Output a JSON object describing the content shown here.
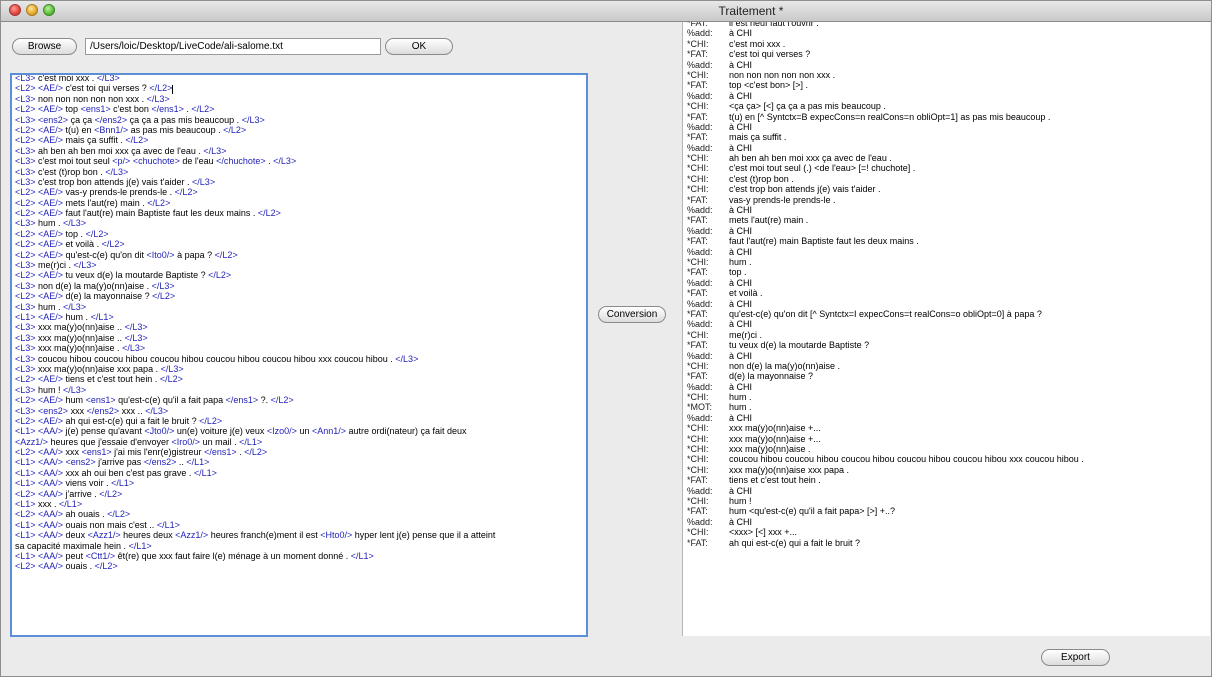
{
  "window": {
    "title": "Traitement *"
  },
  "toolbar": {
    "browse_label": "Browse",
    "path_value": "/Users/loic/Desktop/LiveCode/ali-salome.txt",
    "ok_label": "OK"
  },
  "conversion_label": "Conversion",
  "export_label": "Export",
  "editor_lines": [
    [
      [
        "t",
        "<L3>"
      ],
      [
        "x",
        " c'est moi xxx . "
      ],
      [
        "t",
        "</L3>"
      ]
    ],
    [
      [
        "t",
        "<L2> <AE/>"
      ],
      [
        "x",
        " c'est toi qui verses ? "
      ],
      [
        "t",
        "</L2>"
      ]
    ],
    [
      [
        "t",
        "<L3>"
      ],
      [
        "x",
        " non non non non non xxx . "
      ],
      [
        "t",
        "</L3>"
      ]
    ],
    [
      [
        "t",
        "<L2> <AE/>"
      ],
      [
        "x",
        " top "
      ],
      [
        "t",
        "<ens1>"
      ],
      [
        "x",
        " c'est bon "
      ],
      [
        "t",
        "</ens1>"
      ],
      [
        "x",
        " . "
      ],
      [
        "t",
        "</L2>"
      ]
    ],
    [
      [
        "t",
        "<L3> <ens2>"
      ],
      [
        "x",
        " ça ça "
      ],
      [
        "t",
        "</ens2>"
      ],
      [
        "x",
        " ça ça a pas mis beaucoup . "
      ],
      [
        "t",
        "</L3>"
      ]
    ],
    [
      [
        "t",
        "<L2> <AE/>"
      ],
      [
        "x",
        " t(u) en "
      ],
      [
        "t",
        "<Bnn1/>"
      ],
      [
        "x",
        " as pas mis beaucoup . "
      ],
      [
        "t",
        "</L2>"
      ]
    ],
    [
      [
        "t",
        "<L2> <AE/>"
      ],
      [
        "x",
        " mais ça suffit . "
      ],
      [
        "t",
        "</L2>"
      ]
    ],
    [
      [
        "t",
        "<L3>"
      ],
      [
        "x",
        " ah ben ah ben moi xxx ça avec de l'eau . "
      ],
      [
        "t",
        "</L3>"
      ]
    ],
    [
      [
        "t",
        "<L3>"
      ],
      [
        "x",
        " c'est moi tout seul "
      ],
      [
        "t",
        "<p/> <chuchote>"
      ],
      [
        "x",
        " de l'eau "
      ],
      [
        "t",
        "</chuchote>"
      ],
      [
        "x",
        " . "
      ],
      [
        "t",
        "</L3>"
      ]
    ],
    [
      [
        "t",
        "<L3>"
      ],
      [
        "x",
        " c'est (t)rop bon . "
      ],
      [
        "t",
        "</L3>"
      ]
    ],
    [
      [
        "t",
        "<L3>"
      ],
      [
        "x",
        " c'est trop bon attends j(e) vais t'aider . "
      ],
      [
        "t",
        "</L3>"
      ]
    ],
    [
      [
        "t",
        "<L2> <AE/>"
      ],
      [
        "x",
        " vas-y prends-le prends-le . "
      ],
      [
        "t",
        "</L2>"
      ]
    ],
    [
      [
        "t",
        "<L2> <AE/>"
      ],
      [
        "x",
        " mets l'aut(re) main . "
      ],
      [
        "t",
        "</L2>"
      ]
    ],
    [
      [
        "t",
        "<L2> <AE/>"
      ],
      [
        "x",
        " faut l'aut(re) main Baptiste faut les deux mains . "
      ],
      [
        "t",
        "</L2>"
      ]
    ],
    [
      [
        "t",
        "<L3>"
      ],
      [
        "x",
        " hum . "
      ],
      [
        "t",
        "</L3>"
      ]
    ],
    [
      [
        "t",
        "<L2> <AE/>"
      ],
      [
        "x",
        " top . "
      ],
      [
        "t",
        "</L2>"
      ]
    ],
    [
      [
        "t",
        "<L2> <AE/>"
      ],
      [
        "x",
        " et voilà . "
      ],
      [
        "t",
        "</L2>"
      ]
    ],
    [
      [
        "t",
        "<L2> <AE/>"
      ],
      [
        "x",
        " qu'est-c(e) qu'on dit "
      ],
      [
        "t",
        "<Ito0/>"
      ],
      [
        "x",
        " à papa ? "
      ],
      [
        "t",
        "</L2>"
      ]
    ],
    [
      [
        "t",
        "<L3>"
      ],
      [
        "x",
        " me(r)ci . "
      ],
      [
        "t",
        "</L3>"
      ]
    ],
    [
      [
        "t",
        "<L2> <AE/>"
      ],
      [
        "x",
        " tu veux d(e) la moutarde Baptiste ? "
      ],
      [
        "t",
        "</L2>"
      ]
    ],
    [
      [
        "t",
        "<L3>"
      ],
      [
        "x",
        " non d(e) la ma(y)o(nn)aise . "
      ],
      [
        "t",
        "</L3>"
      ]
    ],
    [
      [
        "t",
        "<L2> <AE/>"
      ],
      [
        "x",
        " d(e) la mayonnaise ? "
      ],
      [
        "t",
        "</L2>"
      ]
    ],
    [
      [
        "t",
        "<L3>"
      ],
      [
        "x",
        " hum . "
      ],
      [
        "t",
        "</L3>"
      ]
    ],
    [
      [
        "t",
        "<L1> <AE/>"
      ],
      [
        "x",
        " hum . "
      ],
      [
        "t",
        "</L1>"
      ]
    ],
    [
      [
        "t",
        "<L3>"
      ],
      [
        "x",
        " xxx ma(y)o(nn)aise .. "
      ],
      [
        "t",
        "</L3>"
      ]
    ],
    [
      [
        "t",
        "<L3>"
      ],
      [
        "x",
        " xxx ma(y)o(nn)aise .. "
      ],
      [
        "t",
        "</L3>"
      ]
    ],
    [
      [
        "t",
        "<L3>"
      ],
      [
        "x",
        " xxx ma(y)o(nn)aise . "
      ],
      [
        "t",
        "</L3>"
      ]
    ],
    [
      [
        "t",
        "<L3>"
      ],
      [
        "x",
        " coucou hibou coucou hibou coucou hibou coucou hibou coucou hibou xxx coucou hibou . "
      ],
      [
        "t",
        "</L3>"
      ]
    ],
    [
      [
        "t",
        "<L3>"
      ],
      [
        "x",
        " xxx ma(y)o(nn)aise xxx papa . "
      ],
      [
        "t",
        "</L3>"
      ]
    ],
    [
      [
        "t",
        "<L2> <AE/>"
      ],
      [
        "x",
        " tiens et c'est tout hein . "
      ],
      [
        "t",
        "</L2>"
      ]
    ],
    [
      [
        "t",
        "<L3>"
      ],
      [
        "x",
        " hum ! "
      ],
      [
        "t",
        "</L3>"
      ]
    ],
    [
      [
        "t",
        "<L2> <AE/>"
      ],
      [
        "x",
        " hum "
      ],
      [
        "t",
        "<ens1>"
      ],
      [
        "x",
        " qu'est-c(e) qu'il a fait papa "
      ],
      [
        "t",
        "</ens1>"
      ],
      [
        "x",
        " ?. "
      ],
      [
        "t",
        "</L2>"
      ]
    ],
    [
      [
        "t",
        "<L3> <ens2>"
      ],
      [
        "x",
        " xxx "
      ],
      [
        "t",
        "</ens2>"
      ],
      [
        "x",
        " xxx .. "
      ],
      [
        "t",
        "</L3>"
      ]
    ],
    [
      [
        "t",
        "<L2> <AE/>"
      ],
      [
        "x",
        " ah qui est-c(e) qui a fait le bruit ? "
      ],
      [
        "t",
        "</L2>"
      ]
    ],
    [
      [
        "t",
        "<L1> <AA/>"
      ],
      [
        "x",
        " j(e) pense qu'avant "
      ],
      [
        "t",
        "<Jto0/>"
      ],
      [
        "x",
        " un(e) voiture j(e) veux "
      ],
      [
        "t",
        "<Izo0/>"
      ],
      [
        "x",
        " un "
      ],
      [
        "t",
        "<Ann1/>"
      ],
      [
        "x",
        " autre ordi(nateur) ça fait deux"
      ]
    ],
    [
      [
        "t",
        "<Azz1/>"
      ],
      [
        "x",
        " heures que j'essaie d'envoyer "
      ],
      [
        "t",
        "<Iro0/>"
      ],
      [
        "x",
        " un mail . "
      ],
      [
        "t",
        "</L1>"
      ]
    ],
    [
      [
        "t",
        "<L2> <AA/>"
      ],
      [
        "x",
        " xxx "
      ],
      [
        "t",
        "<ens1>"
      ],
      [
        "x",
        " j'ai mis l'enr(e)gistreur "
      ],
      [
        "t",
        "</ens1>"
      ],
      [
        "x",
        " . "
      ],
      [
        "t",
        "</L2>"
      ]
    ],
    [
      [
        "t",
        "<L1> <AA/> <ens2>"
      ],
      [
        "x",
        " j'arrive pas "
      ],
      [
        "t",
        "</ens2>"
      ],
      [
        "x",
        " .. "
      ],
      [
        "t",
        "</L1>"
      ]
    ],
    [
      [
        "t",
        "<L1> <AA/>"
      ],
      [
        "x",
        " xxx ah oui ben c'est pas grave . "
      ],
      [
        "t",
        "</L1>"
      ]
    ],
    [
      [
        "t",
        "<L1> <AA/>"
      ],
      [
        "x",
        " viens voir . "
      ],
      [
        "t",
        "</L1>"
      ]
    ],
    [
      [
        "t",
        "<L2> <AA/>"
      ],
      [
        "x",
        " j'arrive . "
      ],
      [
        "t",
        "</L2>"
      ]
    ],
    [
      [
        "t",
        "<L1>"
      ],
      [
        "x",
        " xxx . "
      ],
      [
        "t",
        "</L1>"
      ]
    ],
    [
      [
        "t",
        "<L2> <AA/>"
      ],
      [
        "x",
        " ah ouais . "
      ],
      [
        "t",
        "</L2>"
      ]
    ],
    [
      [
        "t",
        "<L1> <AA/>"
      ],
      [
        "x",
        " ouais non mais c'est .. "
      ],
      [
        "t",
        "</L1>"
      ]
    ],
    [
      [
        "t",
        "<L1> <AA/>"
      ],
      [
        "x",
        " deux "
      ],
      [
        "t",
        "<Azz1/>"
      ],
      [
        "x",
        " heures deux "
      ],
      [
        "t",
        "<Azz1/>"
      ],
      [
        "x",
        " heures franch(e)ment il est "
      ],
      [
        "t",
        "<Hto0/>"
      ],
      [
        "x",
        " hyper lent j(e) pense que il a atteint"
      ]
    ],
    [
      [
        "x",
        "sa capacité maximale hein . "
      ],
      [
        "t",
        "</L1>"
      ]
    ],
    [
      [
        "t",
        "<L1> <AA/>"
      ],
      [
        "x",
        " peut "
      ],
      [
        "t",
        "<Ctt1/>"
      ],
      [
        "x",
        " êt(re) que xxx faut faire l(e) ménage à un moment donné . "
      ],
      [
        "t",
        "</L1>"
      ]
    ],
    [
      [
        "t",
        "<L2> <AA/>"
      ],
      [
        "x",
        " ouais . "
      ],
      [
        "t",
        "</L2>"
      ]
    ]
  ],
  "output_lines": [
    [
      "*FAT:",
      "il est neuf faut l'ouvrir ."
    ],
    [
      "%add:",
      "à CHI"
    ],
    [
      "*CHI:",
      "c'est moi xxx ."
    ],
    [
      "*FAT:",
      "c'est toi qui verses ?"
    ],
    [
      "%add:",
      "à CHI"
    ],
    [
      "*CHI:",
      "non non non non non xxx ."
    ],
    [
      "*FAT:",
      "top <c'est bon> [>] ."
    ],
    [
      "%add:",
      "à CHI"
    ],
    [
      "*CHI:",
      "<ça ça> [<] ça ça a pas mis beaucoup ."
    ],
    [
      "*FAT:",
      "t(u) en [^ Syntctx=B expecCons=n realCons=n obliOpt=1] as pas mis beaucoup ."
    ],
    [
      "%add:",
      "à CHI"
    ],
    [
      "*FAT:",
      "mais ça suffit ."
    ],
    [
      "%add:",
      "à CHI"
    ],
    [
      "*CHI:",
      "ah ben ah ben moi xxx ça avec de l'eau ."
    ],
    [
      "*CHI:",
      "c'est moi tout seul (.) <de l'eau> [=! chuchote] ."
    ],
    [
      "*CHI:",
      "c'est (t)rop bon ."
    ],
    [
      "*CHI:",
      "c'est trop bon attends j(e) vais t'aider ."
    ],
    [
      "*FAT:",
      "vas-y prends-le prends-le ."
    ],
    [
      "%add:",
      "à CHI"
    ],
    [
      "*FAT:",
      "mets l'aut(re) main ."
    ],
    [
      "%add:",
      "à CHI"
    ],
    [
      "*FAT:",
      "faut l'aut(re) main Baptiste faut les deux mains ."
    ],
    [
      "%add:",
      "à CHI"
    ],
    [
      "*CHI:",
      "hum ."
    ],
    [
      "*FAT:",
      "top ."
    ],
    [
      "%add:",
      "à CHI"
    ],
    [
      "*FAT:",
      "et voilà ."
    ],
    [
      "%add:",
      "à CHI"
    ],
    [
      "*FAT:",
      "qu'est-c(e) qu'on dit [^ Syntctx=I expecCons=t realCons=o obliOpt=0] à papa ?"
    ],
    [
      "%add:",
      "à CHI"
    ],
    [
      "*CHI:",
      "me(r)ci ."
    ],
    [
      "*FAT:",
      "tu veux d(e) la moutarde Baptiste ?"
    ],
    [
      "%add:",
      "à CHI"
    ],
    [
      "*CHI:",
      "non d(e) la ma(y)o(nn)aise ."
    ],
    [
      "*FAT:",
      "d(e) la mayonnaise ?"
    ],
    [
      "%add:",
      "à CHI"
    ],
    [
      "*CHI:",
      "hum ."
    ],
    [
      "*MOT:",
      "hum ."
    ],
    [
      "%add:",
      "à CHI"
    ],
    [
      "*CHI:",
      "xxx ma(y)o(nn)aise +..."
    ],
    [
      "*CHI:",
      "xxx ma(y)o(nn)aise +..."
    ],
    [
      "*CHI:",
      "xxx ma(y)o(nn)aise ."
    ],
    [
      "*CHI:",
      "coucou hibou coucou hibou coucou hibou coucou hibou coucou hibou xxx coucou hibou ."
    ],
    [
      "*CHI:",
      "xxx ma(y)o(nn)aise xxx papa ."
    ],
    [
      "*FAT:",
      "tiens et c'est tout hein ."
    ],
    [
      "%add:",
      "à CHI"
    ],
    [
      "*CHI:",
      "hum !"
    ],
    [
      "*FAT:",
      "hum <qu'est-c(e) qu'il a fait papa> [>] +..?"
    ],
    [
      "%add:",
      "à CHI"
    ],
    [
      "*CHI:",
      "<xxx> [<] xxx +..."
    ],
    [
      "*FAT:",
      "ah qui est-c(e) qui a fait le bruit ?"
    ]
  ]
}
